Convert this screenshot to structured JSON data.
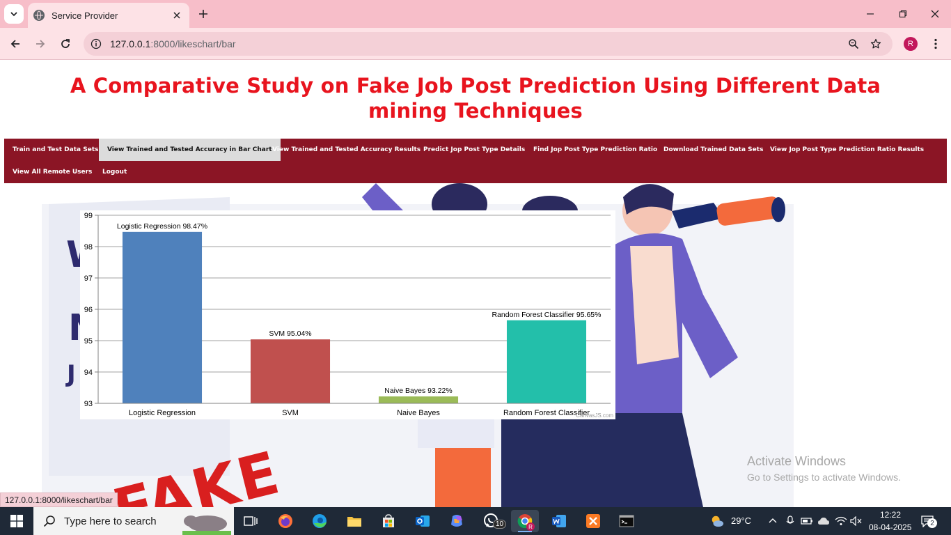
{
  "browser": {
    "tab_title": "Service Provider",
    "url_host": "127.0.0.1",
    "url_path": ":8000/likeschart/bar",
    "profile_initial": "R",
    "status_url": "127.0.0.1:8000/likeschart/bar"
  },
  "page": {
    "heading": "A Comparative Study on Fake Job Post Prediction Using Different Data mining Techniques",
    "nav": [
      {
        "label": "Train and Test Data Sets",
        "active": false
      },
      {
        "label": "View Trained and Tested Accuracy in Bar Chart",
        "active": true
      },
      {
        "label": "View Trained and Tested Accuracy Results",
        "active": false
      },
      {
        "label": "Predict Jop Post Type Details",
        "active": false
      },
      {
        "label": "Find Jop Post Type Prediction Ratio",
        "active": false
      },
      {
        "label": "Download Trained Data Sets",
        "active": false
      },
      {
        "label": "View Jop Post Type Prediction Ratio Results",
        "active": false
      },
      {
        "label": "View All Remote Users",
        "active": false
      },
      {
        "label": "Logout",
        "active": false
      }
    ],
    "background_text": "FAKE",
    "background_fragments": [
      "W",
      "N",
      "J"
    ],
    "activate_windows": {
      "title": "Activate Windows",
      "subtitle": "Go to Settings to activate Windows."
    }
  },
  "chart_data": {
    "type": "bar",
    "categories": [
      "Logistic Regression",
      "SVM",
      "Naive Bayes",
      "Random Forest Classifier"
    ],
    "values": [
      98.47,
      95.04,
      93.22,
      95.65
    ],
    "data_labels": [
      "Logistic Regression 98.47%",
      "SVM 95.04%",
      "Naive Bayes 93.22%",
      "Random Forest Classifier 95.65%"
    ],
    "colors": [
      "#4f81bc",
      "#c0504e",
      "#9bbb58",
      "#23bfaa"
    ],
    "yticks": [
      93,
      94,
      95,
      96,
      97,
      98,
      99
    ],
    "ylim": [
      93,
      99
    ],
    "grid": true,
    "credit": "CanvasJS.com"
  },
  "taskbar": {
    "search_placeholder": "Type here to search",
    "whatsapp_badge": "10",
    "weather": "29°C",
    "time": "12:22",
    "date": "08-04-2025",
    "notification_count": "2",
    "apps": [
      "task-view",
      "firefox",
      "edge",
      "file-explorer",
      "store",
      "outlook",
      "copilot",
      "whatsapp",
      "chrome",
      "word",
      "xampp",
      "terminal"
    ]
  },
  "colors": {
    "tabbar": "#f7bec9",
    "heading": "#e8141e",
    "navbar": "#8b1525",
    "nav_active": "#dcdcdc"
  }
}
